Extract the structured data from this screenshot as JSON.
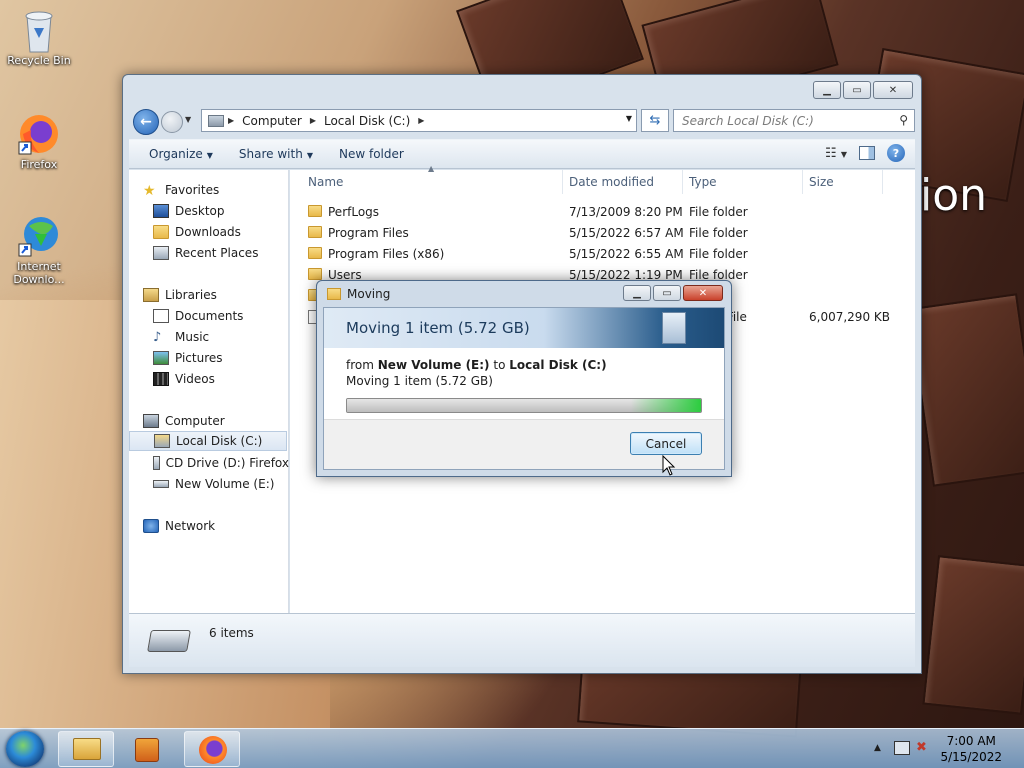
{
  "desktop": {
    "icons": [
      {
        "label": "Recycle Bin"
      },
      {
        "label": "Firefox"
      },
      {
        "label": "Internet Downlo..."
      }
    ],
    "wallpaper_text": "ion"
  },
  "explorer": {
    "address": {
      "crumbs": [
        "Computer",
        "Local Disk (C:)"
      ]
    },
    "search_placeholder": "Search Local Disk (C:)",
    "commands": {
      "organize": "Organize",
      "share_with": "Share with",
      "new_folder": "New folder"
    },
    "nav": {
      "favorites": "Favorites",
      "desktop": "Desktop",
      "downloads": "Downloads",
      "recent_places": "Recent Places",
      "libraries": "Libraries",
      "documents": "Documents",
      "music": "Music",
      "pictures": "Pictures",
      "videos": "Videos",
      "computer": "Computer",
      "local_disk_c": "Local Disk (C:)",
      "cd_drive": "CD Drive (D:) Firefox",
      "new_volume": "New Volume (E:)",
      "network": "Network"
    },
    "columns": {
      "name": "Name",
      "date_modified": "Date modified",
      "type": "Type",
      "size": "Size"
    },
    "rows": [
      {
        "name": "PerfLogs",
        "date": "7/13/2009 8:20 PM",
        "type": "File folder",
        "size": ""
      },
      {
        "name": "Program Files",
        "date": "5/15/2022 6:57 AM",
        "type": "File folder",
        "size": ""
      },
      {
        "name": "Program Files (x86)",
        "date": "5/15/2022 6:55 AM",
        "type": "File folder",
        "size": ""
      },
      {
        "name": "Users",
        "date": "5/15/2022 1:19 PM",
        "type": "File folder",
        "size": ""
      },
      {
        "name": "",
        "date": "",
        "type": "er",
        "size": ""
      },
      {
        "name": "",
        "date": "",
        "type": "ge File",
        "size": "6,007,290 KB"
      }
    ],
    "status": {
      "items": "6 items"
    }
  },
  "dialog": {
    "title": "Moving",
    "heading": "Moving 1 item (5.72 GB)",
    "from_label": "from",
    "source": "New Volume (E:)",
    "to_label": "to",
    "destination": "Local Disk (C:)",
    "detail": "Moving 1 item (5.72 GB)",
    "progress": 0.999,
    "cancel": "Cancel"
  },
  "taskbar": {
    "time": "7:00 AM",
    "date": "5/15/2022"
  }
}
